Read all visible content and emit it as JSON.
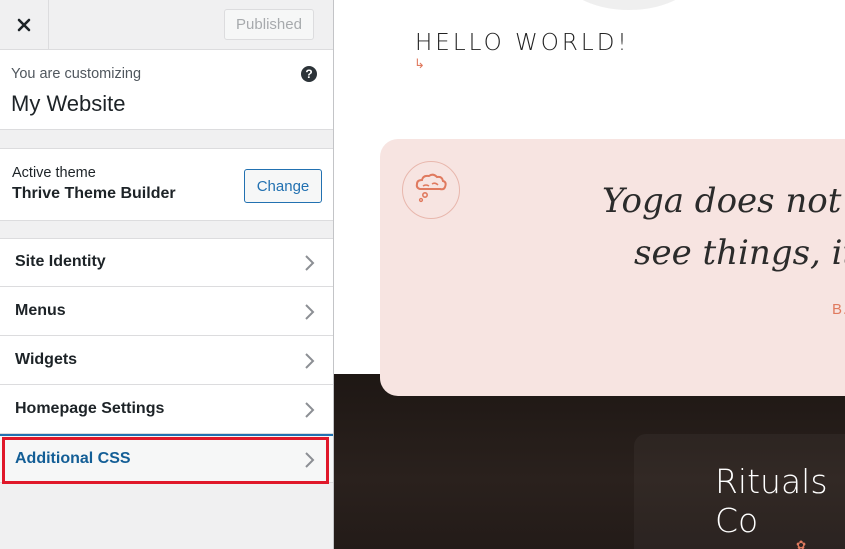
{
  "header": {
    "close_icon": "close-icon",
    "published_label": "Published"
  },
  "customizing": {
    "label": "You are customizing",
    "site_name": "My Website",
    "help_icon": "?"
  },
  "theme": {
    "label": "Active theme",
    "name": "Thrive Theme Builder",
    "change_label": "Change"
  },
  "panels": [
    {
      "label": "Site Identity"
    },
    {
      "label": "Menus"
    },
    {
      "label": "Widgets"
    },
    {
      "label": "Homepage Settings"
    },
    {
      "label": "Additional CSS"
    }
  ],
  "preview": {
    "heading": "HELLO WORLD!",
    "arrow": "↳",
    "quote_line1": "Yoga does not j",
    "quote_line2": "see things, it tr",
    "quote_author": "B.",
    "section_title": "Rituals Co",
    "flower": "✿"
  },
  "colors": {
    "accent": "#2271b1",
    "highlight": "#e0182a",
    "card_bg": "#f7e4e1",
    "coral": "#e07a5f"
  }
}
